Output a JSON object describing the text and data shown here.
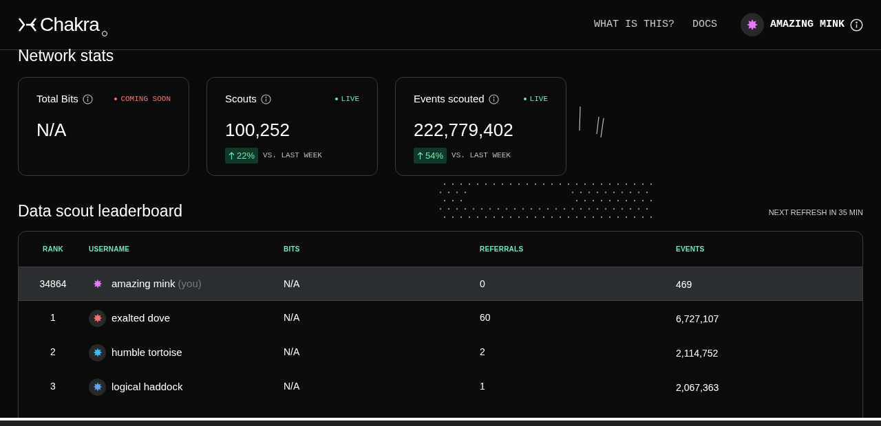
{
  "header": {
    "logo": "Chakra",
    "nav": [
      "WHAT IS THIS?",
      "DOCS"
    ],
    "user": {
      "name": "AMAZING MINK",
      "color": "#e879f9"
    }
  },
  "network_stats": {
    "title": "Network stats",
    "cards": [
      {
        "title": "Total Bits",
        "badge": "COMING SOON",
        "color": "#f87171",
        "value": "N/A"
      },
      {
        "title": "Scouts",
        "badge": "LIVE",
        "color": "#6ee7b7",
        "value": "100,252",
        "change": "22%",
        "change_label": "VS. LAST WEEK"
      },
      {
        "title": "Events scouted",
        "badge": "LIVE",
        "color": "#6ee7b7",
        "value": "222,779,402",
        "change": "54%",
        "change_label": "VS. LAST WEEK"
      }
    ]
  },
  "leaderboard": {
    "title": "Data scout leaderboard",
    "refresh": "NEXT REFRESH IN 35 MIN",
    "columns": [
      "RANK",
      "USERNAME",
      "BITS",
      "REFERRALS",
      "EVENTS"
    ],
    "rows": [
      {
        "rank": "34864",
        "username": "amazing mink",
        "you_tag": "(you)",
        "bits": "N/A",
        "referrals": "0",
        "events": "469",
        "highlighted": true,
        "color": "#e879f9"
      },
      {
        "rank": "1",
        "username": "exalted dove",
        "bits": "N/A",
        "referrals": "60",
        "events": "6,727,107",
        "highlighted": false,
        "color": "#f87171"
      },
      {
        "rank": "2",
        "username": "humble tortoise",
        "bits": "N/A",
        "referrals": "2",
        "events": "2,114,752",
        "highlighted": false,
        "color": "#38bdf8"
      },
      {
        "rank": "3",
        "username": "logical haddock",
        "bits": "N/A",
        "referrals": "1",
        "events": "2,067,363",
        "highlighted": false,
        "color": "#60a5fa"
      }
    ]
  }
}
